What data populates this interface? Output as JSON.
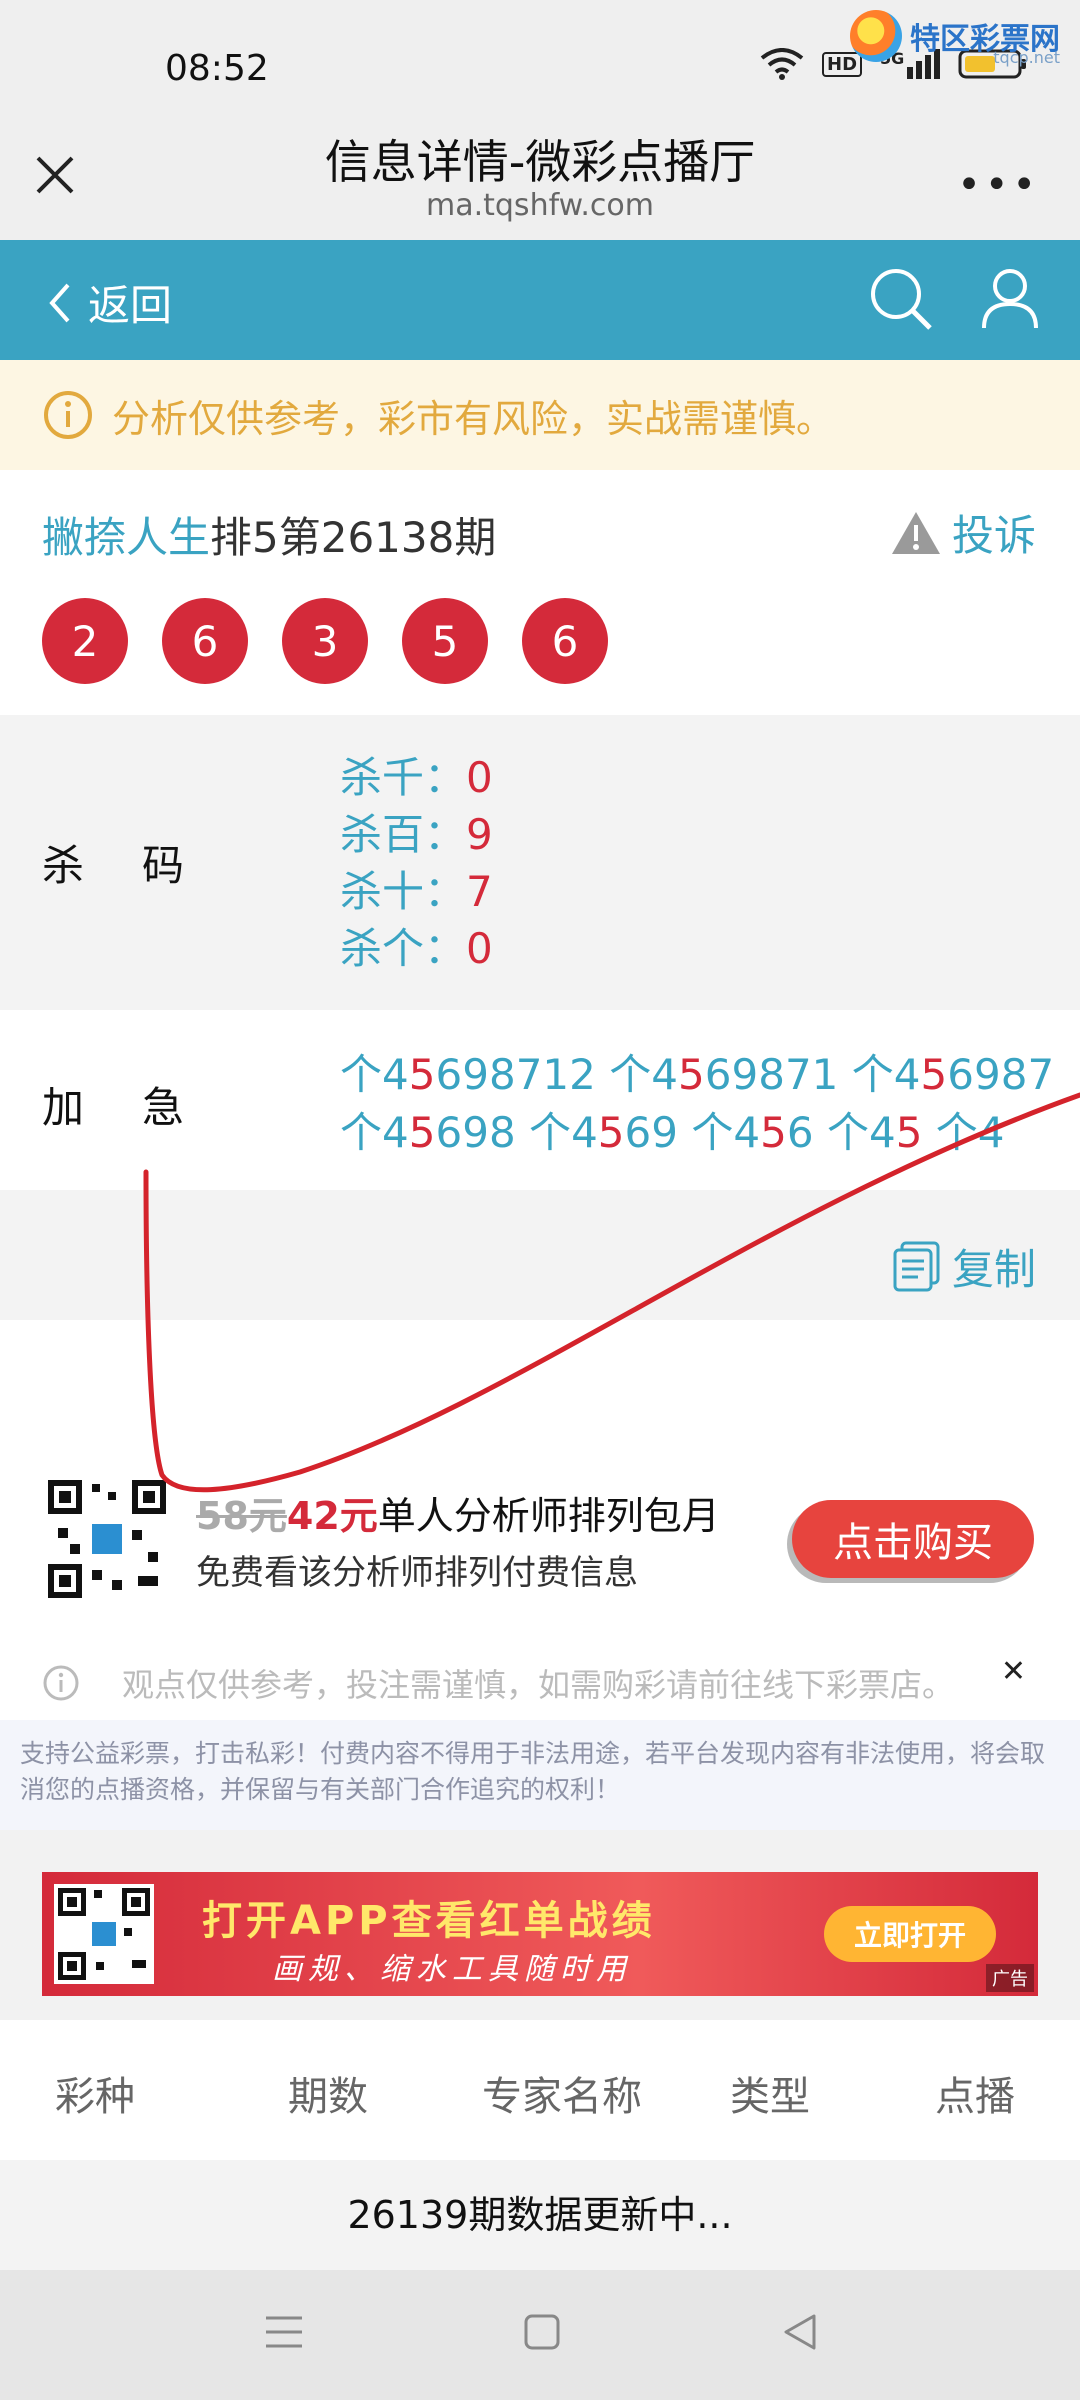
{
  "status": {
    "time": "08:52",
    "hd": "HD",
    "network": "5G"
  },
  "watermark": {
    "name": "特区彩票网",
    "sub": "tqcp.net"
  },
  "titlebar": {
    "title": "信息详情-微彩点播厅",
    "url": "ma.tqshfw.com"
  },
  "appbar": {
    "back_label": "返回"
  },
  "notice": {
    "text": "分析仅供参考，彩市有风险，实战需谨慎。"
  },
  "card": {
    "author": "撇捺人生",
    "issue": "排5第26138期",
    "complain_label": "投诉",
    "balls": [
      "2",
      "6",
      "3",
      "5",
      "6"
    ]
  },
  "kill": {
    "label": "杀码",
    "items": [
      {
        "k": "杀千：",
        "v": "0"
      },
      {
        "k": "杀百：",
        "v": "9"
      },
      {
        "k": "杀十：",
        "v": "7"
      },
      {
        "k": "杀个：",
        "v": "0"
      }
    ]
  },
  "rush": {
    "label": "加急",
    "line1": "个45698712 个4569871 个456987",
    "line2": "个45698 个4569 个456 个45 个4"
  },
  "copy_label": "复制",
  "promo": {
    "old_price": "58元",
    "new_price": "42元",
    "title": "单人分析师排列包月",
    "subtitle": "免费看该分析师排列付费信息",
    "buy_label": "点击购买",
    "tip": "观点仅供参考，投注需谨慎，如需购彩请前往线下彩票店。"
  },
  "disclaimer": "支持公益彩票，打击私彩！付费内容不得用于非法用途，若平台发现内容有非法使用，将会取消您的点播资格，并保留与有关部门合作追究的权利！",
  "banner": {
    "line1": "打开APP查看红单战绩",
    "line2": "画规、缩水工具随时用",
    "button": "立即打开",
    "ad": "广告"
  },
  "table": {
    "headers": [
      "彩种",
      "期数",
      "专家名称",
      "类型",
      "点播"
    ],
    "updating": "26139期数据更新中..."
  },
  "colors": {
    "accent": "#3aa3c2",
    "red": "#d42a3a",
    "notice": "#e2a93e"
  }
}
